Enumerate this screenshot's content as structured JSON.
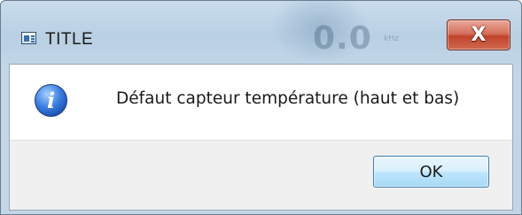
{
  "window": {
    "title": "TITLE",
    "close_glyph": "X",
    "close_icon": "close-icon",
    "app_icon": "application-icon"
  },
  "background_ghost": {
    "value": "0.0",
    "unit": "kHz"
  },
  "dialog": {
    "icon": "information-icon",
    "icon_glyph": "i",
    "message": "Défaut capteur température (haut et bas)",
    "ok_label": "OK"
  },
  "colors": {
    "titlebar": "#b9d0e3",
    "close_button": "#c0432a",
    "info_icon": "#3b7fe0",
    "ok_button_border": "#3c7fb1",
    "footer": "#f0f0f0"
  }
}
